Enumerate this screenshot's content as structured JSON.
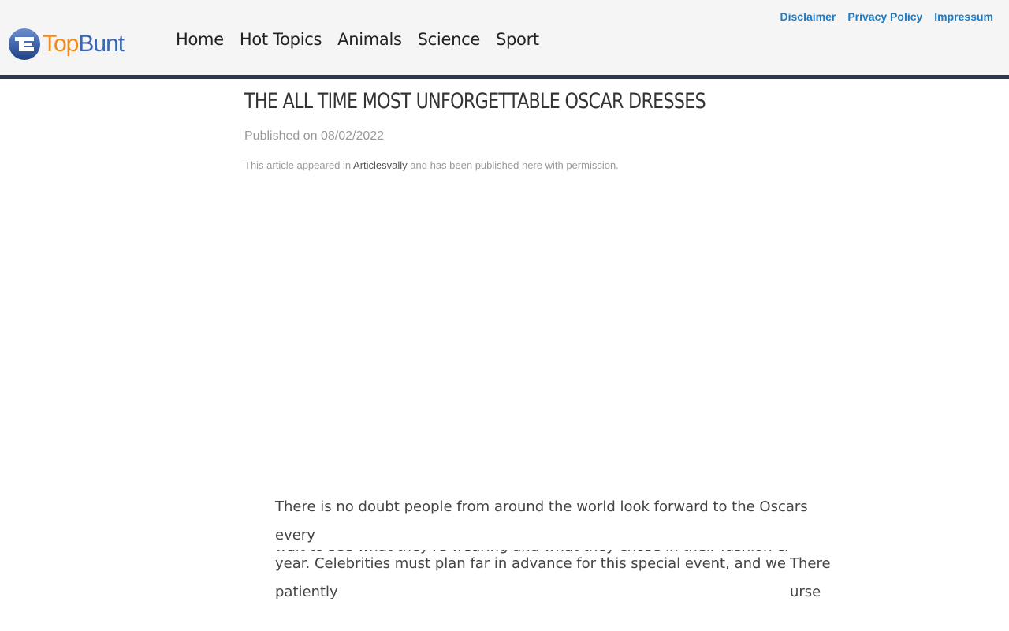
{
  "header": {
    "logo": {
      "part1": "Top",
      "part2": "Bunt"
    },
    "top_links": [
      {
        "label": "Disclaimer"
      },
      {
        "label": "Privacy Policy"
      },
      {
        "label": "Impressum"
      }
    ],
    "nav": [
      {
        "label": "Home"
      },
      {
        "label": "Hot Topics"
      },
      {
        "label": "Animals"
      },
      {
        "label": "Science"
      },
      {
        "label": "Sport"
      }
    ],
    "border_color": "#2c3552"
  },
  "article": {
    "title": "THE ALL TIME MOST UNFORGETTABLE OSCAR DRESSES",
    "published": "Published on 08/02/2022",
    "permission_prefix": "This article appeared in",
    "permission_link": "Articlesvally",
    "permission_suffix": "and has been published here with permission.",
    "body_line1": "There is no doubt people from around the world look forward to the Oscars every",
    "body_line2": "year. Celebrities must plan far in advance for this special event, and we patiently",
    "body_line3_clipped": "wait to see what they're wearing and what they chose in their fashion choices.",
    "float_text_1": "There",
    "float_text_2": "urse"
  },
  "colors": {
    "link_blue": "#1a7bc7",
    "logo_orange": "#f08a1c",
    "logo_blue": "#3a67b1"
  }
}
